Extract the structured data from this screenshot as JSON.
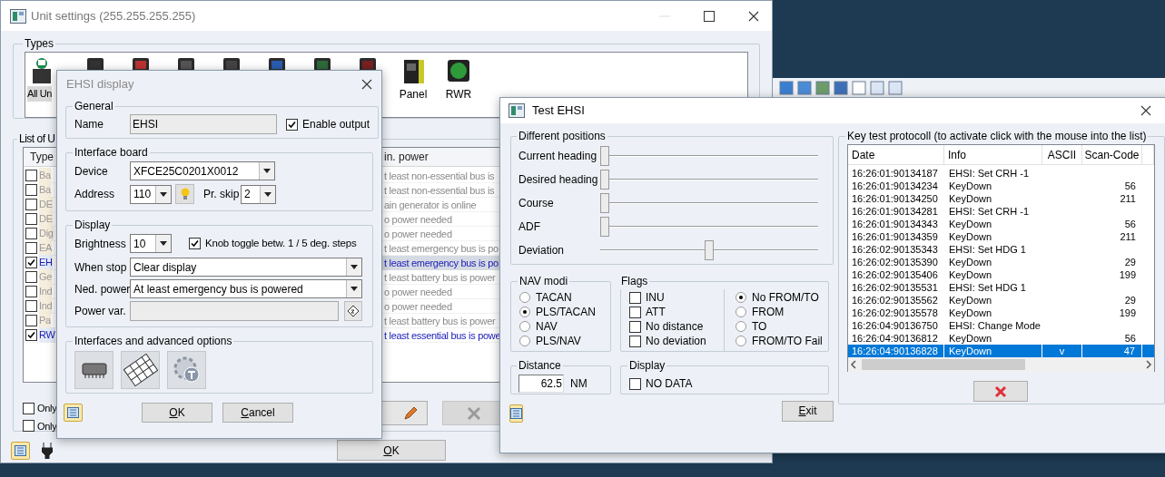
{
  "unit_settings": {
    "title": "Unit settings (255.255.255.255)",
    "types": {
      "label": "Types",
      "items": [
        {
          "label": "All Un",
          "selected": true
        },
        {
          "label": "Panel",
          "selected": false
        },
        {
          "label": "RWR",
          "selected": false
        }
      ]
    },
    "list": {
      "label": "List of U",
      "columns": [
        "Type",
        "in. power"
      ],
      "rows": [
        {
          "type": "Ba",
          "checked": false,
          "selected": false,
          "min_power": "t least non-essential bus is"
        },
        {
          "type": "Ba",
          "checked": false,
          "selected": false,
          "min_power": "t least non-essential bus is"
        },
        {
          "type": "DE",
          "checked": false,
          "selected": false,
          "min_power": "ain generator is online"
        },
        {
          "type": "DE",
          "checked": false,
          "selected": false,
          "min_power": "o power needed"
        },
        {
          "type": "Dig",
          "checked": false,
          "selected": false,
          "min_power": "o power needed"
        },
        {
          "type": "EA",
          "checked": false,
          "selected": false,
          "min_power": "t least emergency bus is po"
        },
        {
          "type": "EH",
          "checked": true,
          "selected": true,
          "min_power": "t least emergency bus is po"
        },
        {
          "type": "Ge",
          "checked": false,
          "selected": false,
          "min_power": "t least battery bus is power"
        },
        {
          "type": "Ind",
          "checked": false,
          "selected": false,
          "min_power": "o power needed"
        },
        {
          "type": "Ind",
          "checked": false,
          "selected": false,
          "min_power": "o power needed"
        },
        {
          "type": "Pa",
          "checked": false,
          "selected": false,
          "min_power": "t least battery bus is power"
        },
        {
          "type": "RW",
          "checked": true,
          "selected": false,
          "min_power": "t least essential bus is powe"
        }
      ]
    },
    "filters": [
      {
        "label": "Only",
        "checked": false
      },
      {
        "label": "Only",
        "checked": false
      }
    ],
    "ok_button": "OK"
  },
  "ehsi_dialog": {
    "title": "EHSI display",
    "general": {
      "label": "General",
      "name_label": "Name",
      "name_value": "EHSI",
      "enable_output": {
        "label": "Enable output",
        "checked": true
      }
    },
    "interface_board": {
      "label": "Interface board",
      "device_label": "Device",
      "device_value": "XFCE25C0201X0012",
      "address_label": "Address",
      "address_value": "110",
      "skip_label": "Pr. skip",
      "skip_value": "2"
    },
    "display": {
      "label": "Display",
      "brightness_label": "Brightness",
      "brightness_value": "10",
      "knob_toggle": {
        "label": "Knob toggle betw.  1 / 5 deg. steps",
        "checked": true
      },
      "when_stop_label": "When stop",
      "when_stop_value": "Clear display",
      "power_label": "Ned. power",
      "power_value": "At least emergency bus is powered",
      "power_var_label": "Power var."
    },
    "advanced": {
      "label": "Interfaces and advanced options"
    },
    "buttons": [
      "OK",
      "Cancel"
    ]
  },
  "test_dialog": {
    "title": "Test EHSI",
    "positions": {
      "label": "Different positions",
      "sliders": [
        {
          "label": "Current heading",
          "level": 0
        },
        {
          "label": "Desired heading",
          "level": 0
        },
        {
          "label": "Course",
          "level": 0
        },
        {
          "label": "ADF",
          "level": 0
        },
        {
          "label": "Deviation",
          "level": 0.5
        }
      ]
    },
    "nav_modi": {
      "label": "NAV modi",
      "options": [
        {
          "label": "TACAN",
          "selected": false
        },
        {
          "label": "PLS/TACAN",
          "selected": true
        },
        {
          "label": "NAV",
          "selected": false
        },
        {
          "label": "PLS/NAV",
          "selected": false
        }
      ]
    },
    "flags": {
      "label": "Flags",
      "checks": [
        {
          "label": "INU",
          "checked": false
        },
        {
          "label": "ATT",
          "checked": false
        },
        {
          "label": "No distance",
          "checked": false
        },
        {
          "label": "No deviation",
          "checked": false
        }
      ],
      "from_to": [
        {
          "label": "No FROM/TO",
          "selected": true
        },
        {
          "label": "FROM",
          "selected": false
        },
        {
          "label": "TO",
          "selected": false
        },
        {
          "label": "FROM/TO Fail",
          "selected": false
        }
      ]
    },
    "distance": {
      "label": "Distance",
      "value": "62.5",
      "unit": "NM"
    },
    "display": {
      "label": "Display",
      "no_data": {
        "label": "NO DATA",
        "checked": false
      }
    },
    "protocol": {
      "label": "Key test protocoll (to activate click with the mouse into the list)",
      "columns": [
        "Date",
        "Info",
        "ASCII",
        "Scan-Code"
      ],
      "rows": [
        {
          "date": "16:26:01:90134187",
          "info": "EHSI: Set CRH -1",
          "selected": false
        },
        {
          "date": "16:26:01:90134234",
          "info": "KeyDown",
          "scan_code": "56",
          "selected": false
        },
        {
          "date": "16:26:01:90134250",
          "info": "KeyDown",
          "scan_code": "211",
          "selected": false
        },
        {
          "date": "16:26:01:90134281",
          "info": "EHSI: Set CRH -1",
          "selected": false
        },
        {
          "date": "16:26:01:90134343",
          "info": "KeyDown",
          "scan_code": "56",
          "selected": false
        },
        {
          "date": "16:26:01:90134359",
          "info": "KeyDown",
          "scan_code": "211",
          "selected": false
        },
        {
          "date": "16:26:02:90135343",
          "info": "EHSI: Set HDG 1",
          "selected": false
        },
        {
          "date": "16:26:02:90135390",
          "info": "KeyDown",
          "scan_code": "29",
          "selected": false
        },
        {
          "date": "16:26:02:90135406",
          "info": "KeyDown",
          "scan_code": "199",
          "selected": false
        },
        {
          "date": "16:26:02:90135531",
          "info": "EHSI: Set HDG 1",
          "selected": false
        },
        {
          "date": "16:26:02:90135562",
          "info": "KeyDown",
          "scan_code": "29",
          "selected": false
        },
        {
          "date": "16:26:02:90135578",
          "info": "KeyDown",
          "scan_code": "199",
          "selected": false
        },
        {
          "date": "16:26:04:90136750",
          "info": "EHSI: Change Mode",
          "selected": false
        },
        {
          "date": "16:26:04:90136812",
          "info": "KeyDown",
          "scan_code": "56",
          "selected": false
        },
        {
          "date": "16:26:04:90136828",
          "info": "KeyDown",
          "ascii": "v",
          "scan_code": "47",
          "selected": true
        }
      ]
    },
    "exit_button": "Exit"
  }
}
